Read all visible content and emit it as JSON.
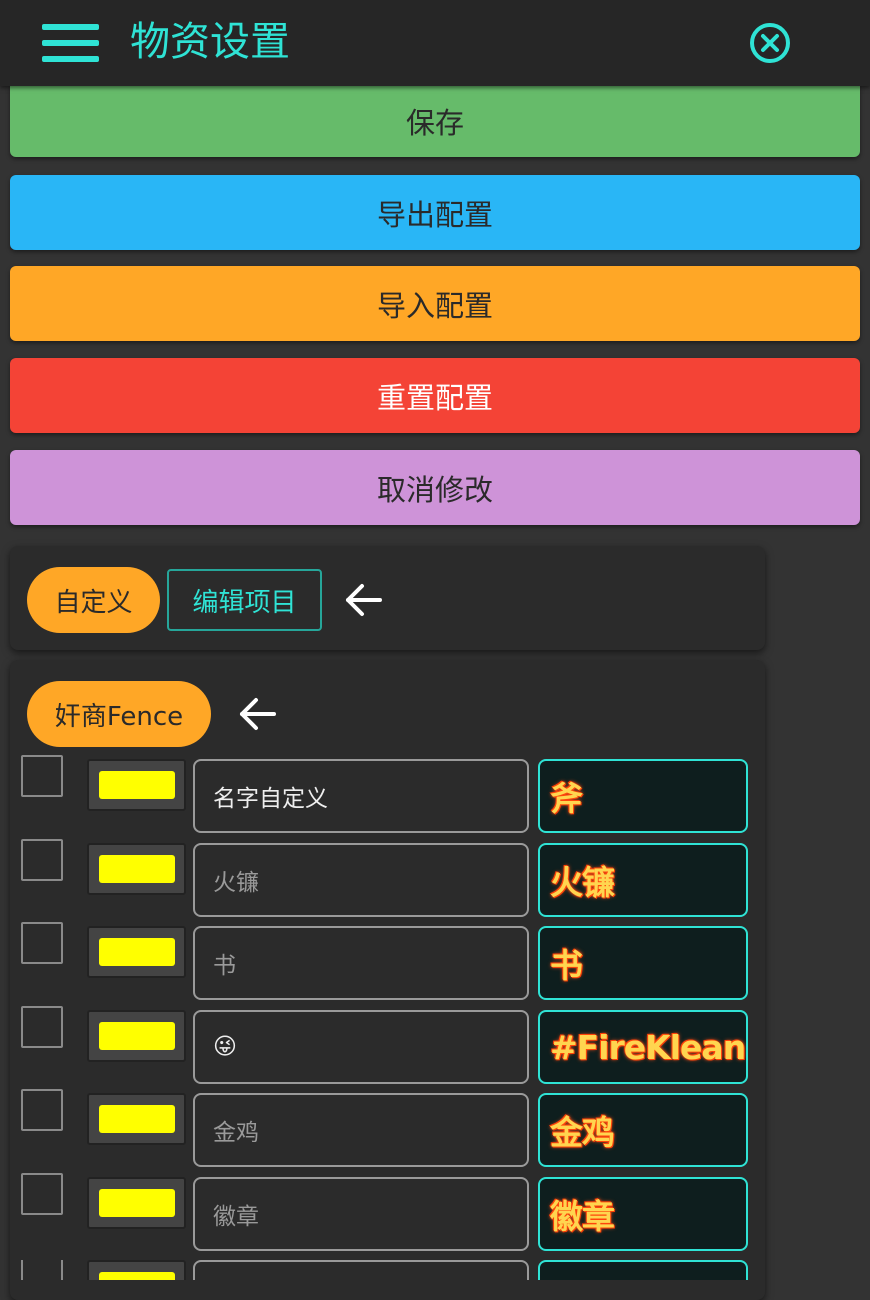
{
  "header": {
    "title": "物资设置",
    "menu_icon": "hamburger-menu-icon",
    "close_icon": "close-circle-icon",
    "accent_color": "#2fe3d5"
  },
  "actions": {
    "save": "保存",
    "export": "导出配置",
    "import": "导入配置",
    "reset": "重置配置",
    "cancel": "取消修改"
  },
  "action_colors": {
    "save": "#66bb6a",
    "export": "#29b6f6",
    "import": "#ffa726",
    "reset": "#f44336",
    "cancel": "#ce93d8"
  },
  "toolbar": {
    "custom_chip": "自定义",
    "edit_items": "编辑项目",
    "back_icon": "arrow-left-icon"
  },
  "group": {
    "name": "奸商Fence",
    "back_icon": "arrow-left-icon"
  },
  "items": [
    {
      "name": "名字自定义",
      "preview": "斧",
      "color": "#ffff00",
      "checked": false
    },
    {
      "name": "火镰",
      "preview": "火镰",
      "color": "#ffff00",
      "checked": false
    },
    {
      "name": "书",
      "preview": "书",
      "color": "#ffff00",
      "checked": false
    },
    {
      "name": "😜",
      "preview": "#FireKlean",
      "color": "#ffff00",
      "checked": false
    },
    {
      "name": "金鸡",
      "preview": "金鸡",
      "color": "#ffff00",
      "checked": false
    },
    {
      "name": "徽章",
      "preview": "徽章",
      "color": "#ffff00",
      "checked": false
    },
    {
      "name": "",
      "preview": "",
      "color": "#ffff00",
      "checked": false
    }
  ]
}
